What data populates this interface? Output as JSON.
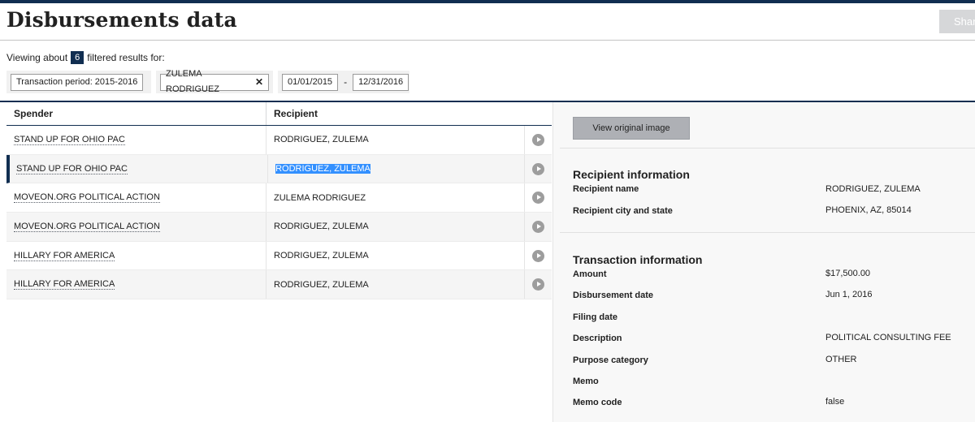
{
  "page": {
    "title": "Disbursements data",
    "share_label": "Shar"
  },
  "summary": {
    "prefix": "Viewing about",
    "count": "6",
    "suffix": "filtered results for:"
  },
  "filters": {
    "period_tag": "Transaction period: 2015-2016",
    "recipient_tag": "ZULEMA RODRIGUEZ",
    "date_from": "01/01/2015",
    "date_separator": "-",
    "date_to": "12/31/2016"
  },
  "table": {
    "columns": [
      "Spender",
      "Recipient"
    ],
    "rows": [
      {
        "spender": "STAND UP FOR OHIO PAC",
        "recipient": "RODRIGUEZ, ZULEMA"
      },
      {
        "spender": "STAND UP FOR OHIO PAC",
        "recipient": "RODRIGUEZ, ZULEMA"
      },
      {
        "spender": "MOVEON.ORG POLITICAL ACTION",
        "recipient": "ZULEMA RODRIGUEZ"
      },
      {
        "spender": "MOVEON.ORG POLITICAL ACTION",
        "recipient": "RODRIGUEZ, ZULEMA"
      },
      {
        "spender": "HILLARY FOR AMERICA",
        "recipient": "RODRIGUEZ, ZULEMA"
      },
      {
        "spender": "HILLARY FOR AMERICA",
        "recipient": "RODRIGUEZ, ZULEMA"
      }
    ]
  },
  "panel": {
    "view_image_label": "View original image",
    "recipient_heading": "Recipient information",
    "recipient": [
      {
        "label": "Recipient name",
        "value": "RODRIGUEZ, ZULEMA"
      },
      {
        "label": "Recipient city and state",
        "value": "PHOENIX, AZ, 85014"
      }
    ],
    "transaction_heading": "Transaction information",
    "transaction": [
      {
        "label": "Amount",
        "value": "$17,500.00"
      },
      {
        "label": "Disbursement date",
        "value": "Jun 1, 2016"
      },
      {
        "label": "Filing date",
        "value": ""
      },
      {
        "label": "Description",
        "value": "POLITICAL CONSULTING FEE"
      },
      {
        "label": "Purpose category",
        "value": "OTHER"
      },
      {
        "label": "Memo",
        "value": ""
      },
      {
        "label": "Memo code",
        "value": "false"
      }
    ]
  },
  "colors": {
    "primary_navy": "#112e51",
    "selection_blue": "#3390ff",
    "panel_bg": "#f8f8f8"
  }
}
